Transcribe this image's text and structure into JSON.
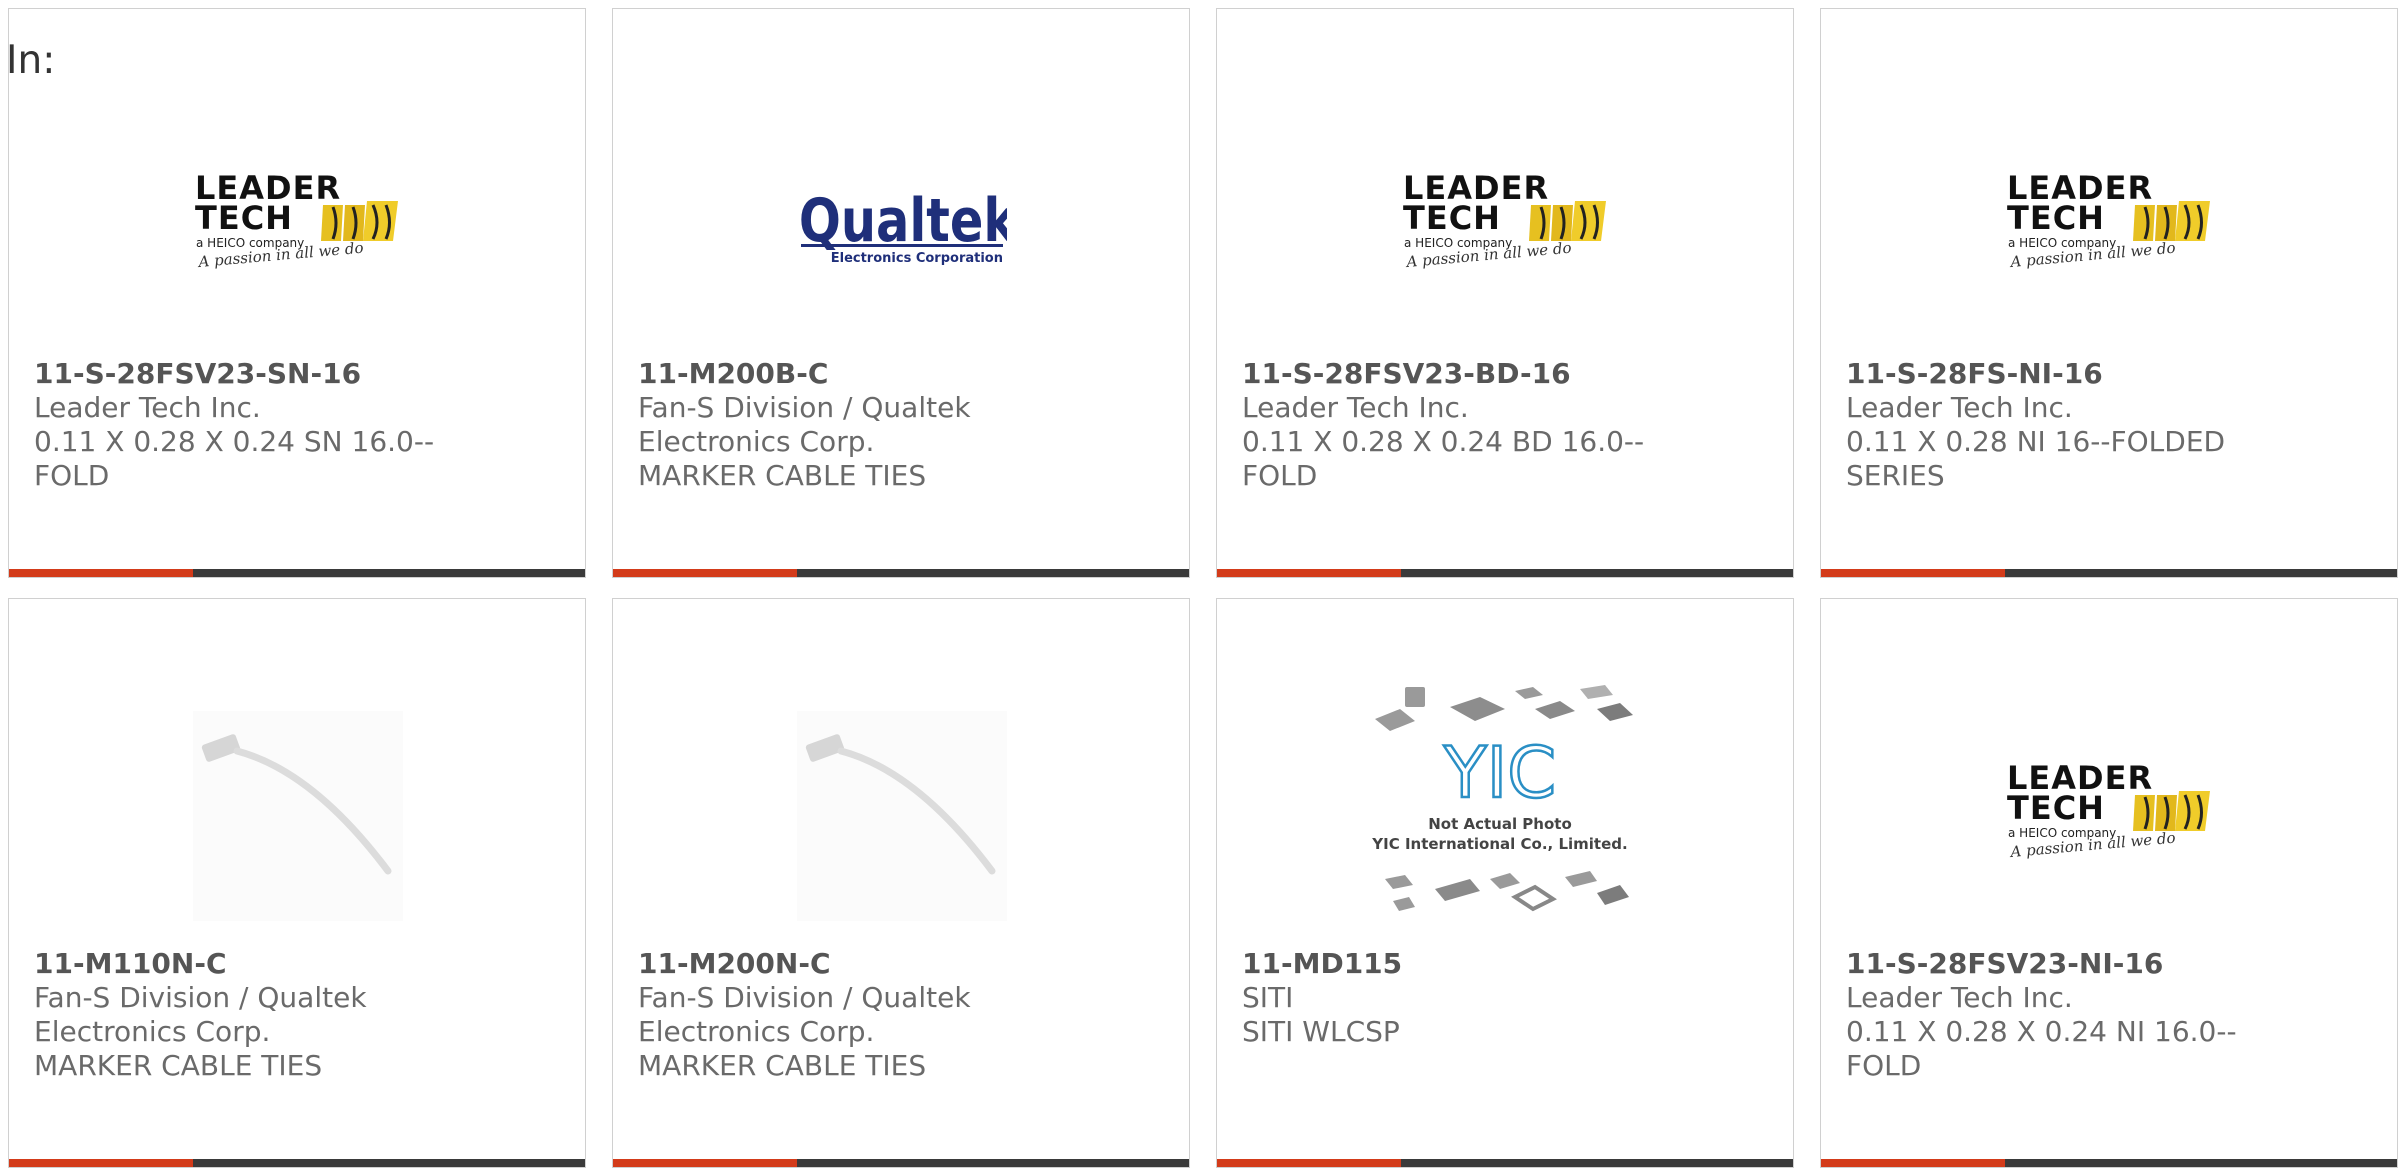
{
  "prefix_label": "In:",
  "accent_color": "#d33b1a",
  "bar_color": "#3a3a3a",
  "products": [
    {
      "part_number": "11-S-28FSV23-SN-16",
      "manufacturer": "Leader Tech Inc.",
      "description": "0.11 X 0.28 X 0.24 SN 16.0--FOLD",
      "image": "leader-tech-logo"
    },
    {
      "part_number": "11-M200B-C",
      "manufacturer": "Fan-S Division / Qualtek Electronics Corp.",
      "description": "MARKER CABLE TIES",
      "image": "qualtek-logo"
    },
    {
      "part_number": "11-S-28FSV23-BD-16",
      "manufacturer": "Leader Tech Inc.",
      "description": "0.11 X 0.28 X 0.24 BD 16.0--FOLD",
      "image": "leader-tech-logo"
    },
    {
      "part_number": "11-S-28FS-NI-16",
      "manufacturer": "Leader Tech Inc.",
      "description": "0.11 X 0.28 NI 16--FOLDED SERIES",
      "image": "leader-tech-logo"
    },
    {
      "part_number": "11-M110N-C",
      "manufacturer": "Fan-S Division / Qualtek Electronics Corp.",
      "description": "MARKER CABLE TIES",
      "image": "cable-tie-photo"
    },
    {
      "part_number": "11-M200N-C",
      "manufacturer": "Fan-S Division / Qualtek Electronics Corp.",
      "description": "MARKER CABLE TIES",
      "image": "cable-tie-photo"
    },
    {
      "part_number": "11-MD115",
      "manufacturer": "SITI",
      "description": "SITI WLCSP",
      "image": "yic-placeholder"
    },
    {
      "part_number": "11-S-28FSV23-NI-16",
      "manufacturer": "Leader Tech Inc.",
      "description": "0.11 X 0.28 X 0.24 NI 16.0--FOLD",
      "image": "leader-tech-logo"
    }
  ],
  "logos": {
    "leader_tech": {
      "line1": "LEADER",
      "line2": "TECH",
      "sub": "a HEICO company",
      "tagline": "A passion in all we do"
    },
    "qualtek": {
      "name": "Qualtek",
      "sub": "Electronics Corporation"
    },
    "yic": {
      "mark": "YIC",
      "line1": "Not Actual Photo",
      "line2": "YIC International Co., Limited."
    }
  }
}
